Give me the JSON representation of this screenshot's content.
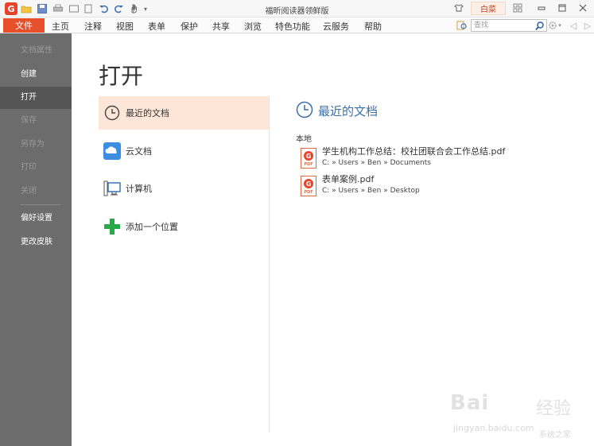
{
  "window": {
    "title": "福昕阅读器领鲜版",
    "skin_label": "白菜"
  },
  "menu": {
    "file": "文件",
    "items": [
      "主页",
      "注释",
      "视图",
      "表单",
      "保护",
      "共享",
      "浏览",
      "特色功能",
      "云服务",
      "帮助"
    ],
    "search_placeholder": "查找"
  },
  "sidebar": {
    "items": [
      {
        "label": "文档属性",
        "state": "disabled"
      },
      {
        "label": "创建",
        "state": "enabled"
      },
      {
        "label": "打开",
        "state": "active"
      },
      {
        "label": "保存",
        "state": "disabled"
      },
      {
        "label": "另存为",
        "state": "disabled"
      },
      {
        "label": "打印",
        "state": "disabled"
      },
      {
        "label": "关闭",
        "state": "disabled"
      },
      {
        "label": "偏好设置",
        "state": "enabled"
      },
      {
        "label": "更改皮肤",
        "state": "enabled"
      }
    ]
  },
  "main": {
    "title": "打开",
    "locations": [
      {
        "label": "最近的文档",
        "icon": "clock-icon",
        "selected": true
      },
      {
        "label": "云文档",
        "icon": "cloud-icon",
        "selected": false
      },
      {
        "label": "计算机",
        "icon": "computer-icon",
        "selected": false
      },
      {
        "label": "添加一个位置",
        "icon": "plus-icon",
        "selected": false
      }
    ],
    "recent": {
      "title": "最近的文档",
      "section_label": "本地",
      "documents": [
        {
          "name": "学生机构工作总结：校社团联合会工作总结.pdf",
          "path": "C: » Users » Ben » Documents"
        },
        {
          "name": "表单案例.pdf",
          "path": "C: » Users » Ben » Desktop"
        }
      ]
    }
  },
  "watermark": {
    "brand": "Bai",
    "brand_tail": "经验",
    "url": "jingyan.baidu.com",
    "note": "系统之家"
  },
  "colors": {
    "accent": "#e8502b",
    "selected_bg": "#fde5d8",
    "sidebar_bg": "#6c6c6c",
    "recent_title": "#3a6fa8"
  }
}
